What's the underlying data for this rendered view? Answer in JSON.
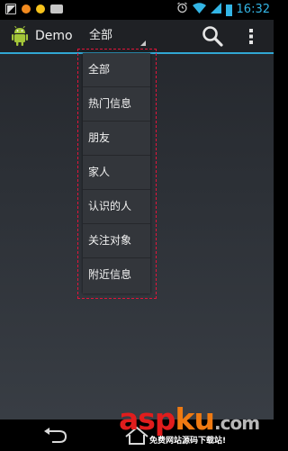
{
  "status_bar": {
    "time": "16:32",
    "icons": {
      "notification": "image-notification-icon",
      "dot1": "orange-dot-icon",
      "dot2": "yellow-dot-icon",
      "cat": "android-cat-icon",
      "alarm": "alarm-clock-icon",
      "wifi": "wifi-icon",
      "signal": "cell-signal-icon",
      "battery": "battery-icon"
    },
    "colors": {
      "time": "#33b5e5",
      "dot1": "#f28a1f",
      "dot2": "#f6c21c"
    }
  },
  "action_bar": {
    "title": "Demo",
    "icon": "android-app-icon",
    "spinner": {
      "selected": "全部"
    },
    "search": "search-icon",
    "overflow": "overflow-menu-icon",
    "accent_color": "#33b5e5"
  },
  "dropdown": {
    "items": [
      {
        "label": "全部"
      },
      {
        "label": "热门信息"
      },
      {
        "label": "朋友"
      },
      {
        "label": "家人"
      },
      {
        "label": "认识的人"
      },
      {
        "label": "关注对象"
      },
      {
        "label": "附近信息"
      }
    ]
  },
  "nav_bar": {
    "back": "back-arrow-icon",
    "home": "home-icon"
  },
  "watermark": {
    "logo_a": "asp",
    "logo_b": "ku",
    "logo_c": ".com",
    "tagline": "免费网站源码下载站!"
  }
}
